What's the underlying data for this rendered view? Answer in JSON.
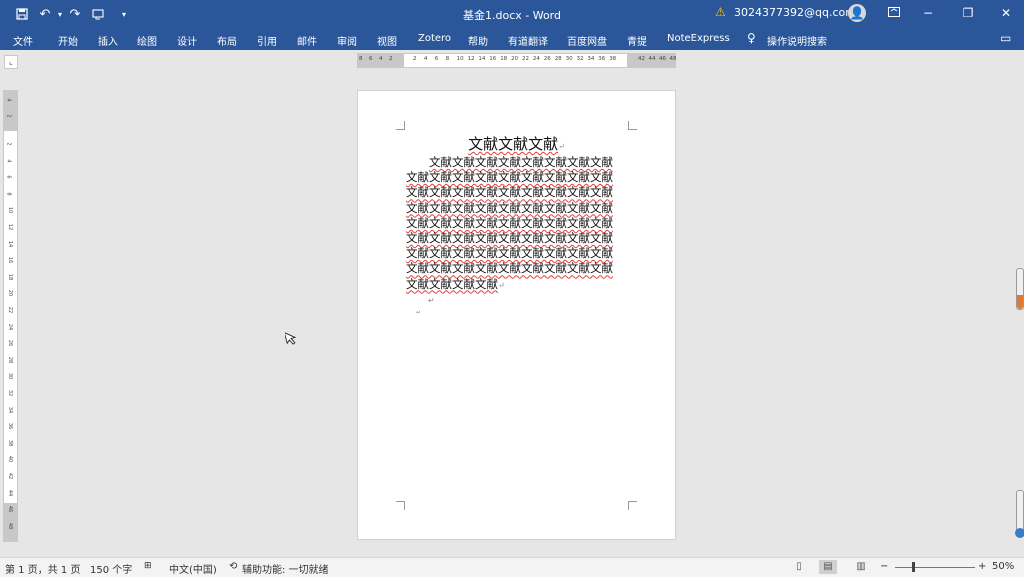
{
  "titlebar": {
    "title": "基金1.docx  -  Word",
    "account": "3024377392@qq.com",
    "qat": {
      "save_icon": "save-icon",
      "undo_icon": "undo-icon",
      "redo_icon": "redo-icon",
      "touch_icon": "touch-mode-icon",
      "customize_icon": "customize-icon"
    }
  },
  "menu": {
    "items": [
      "文件",
      "开始",
      "插入",
      "绘图",
      "设计",
      "布局",
      "引用",
      "邮件",
      "审阅",
      "视图",
      "Zotero",
      "帮助",
      "有道翻译",
      "百度网盘",
      "青提",
      "NoteExpress"
    ],
    "tell_me": "操作说明搜索"
  },
  "ruler": {
    "left_ticks": [
      "8",
      "6",
      "4",
      "2"
    ],
    "ticks": [
      "2",
      "4",
      "6",
      "8",
      "10",
      "12",
      "14",
      "16",
      "18",
      "20",
      "22",
      "24",
      "26",
      "28",
      "30",
      "32",
      "34",
      "36",
      "38"
    ],
    "right_ticks": [
      "42",
      "44",
      "46",
      "48"
    ],
    "vertical_ticks": [
      "4",
      "2",
      "2",
      "4",
      "6",
      "8",
      "10",
      "12",
      "14",
      "16",
      "18",
      "20",
      "22",
      "24",
      "26",
      "28",
      "30",
      "32",
      "34",
      "36",
      "38",
      "40",
      "42",
      "44",
      "46",
      "48"
    ]
  },
  "document": {
    "title": "文献文献文献",
    "body": "文献文献文献文献文献文献文献文献文献文献文献文献文献文献文献文献文献文献文献文献文献文献文献文献文献文献文献文献文献文献文献文献文献文献文献文献文献文献文献文献文献文献文献文献文献文献文献文献文献文献文献文献文献文献文献文献文献文献文献文献文献文献文献文献文献文献文献文献文献文献文献文献文献文献文献",
    "para_mark": "↵"
  },
  "status": {
    "page": "第 1 页，共 1 页",
    "words": "150 个字",
    "language": "中文(中国)",
    "accessibility": "辅助功能: 一切就绪",
    "zoom_minus": "−",
    "zoom_plus": "+",
    "zoom": "50%",
    "zoom_level_percent": 50
  }
}
